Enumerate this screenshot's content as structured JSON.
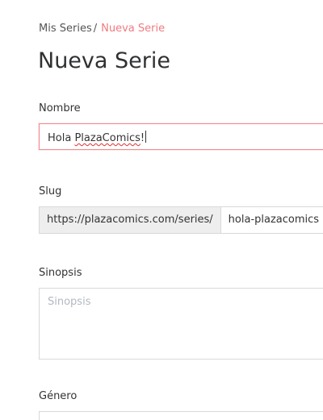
{
  "breadcrumb": {
    "parent": "Mis Series",
    "separator": "/",
    "current": "Nueva Serie"
  },
  "page": {
    "title": "Nueva Serie"
  },
  "form": {
    "name": {
      "label": "Nombre",
      "value_prefix": "Hola ",
      "value_misspelled": "PlazaComics",
      "value_suffix": "!"
    },
    "slug": {
      "label": "Slug",
      "prefix": "https://plazacomics.com/series/",
      "value": "hola-plazacomics"
    },
    "synopsis": {
      "label": "Sinopsis",
      "placeholder": "Sinopsis",
      "value": ""
    },
    "genre": {
      "label": "Género"
    }
  },
  "colors": {
    "accent": "#f07a80",
    "input_border": "#d9d9d9",
    "focus_border": "#f08a8f",
    "addon_bg": "#eeeeee",
    "placeholder": "#b3b9c0"
  }
}
